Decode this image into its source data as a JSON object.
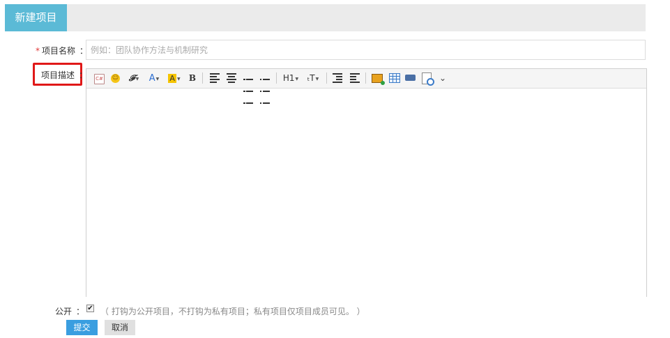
{
  "header": {
    "title": "新建项目"
  },
  "form": {
    "name_required_mark": "*",
    "name_label": "项目名称",
    "colon": "：",
    "name_placeholder": "例如：团队协作方法与机制研究",
    "desc_label": "项目描述",
    "open_label": "公开",
    "open_checked": true,
    "check_glyph": "✔",
    "open_hint": "（ 打钩为公开项目，不打钩为私有项目；私有项目仅项目成员可见。 ）",
    "submit_label": "提交",
    "cancel_label": "取消"
  },
  "toolbar": {
    "html_glyph": "C#",
    "emoticon_glyph": "☺",
    "font_glyph": "𝓕",
    "font_color_glyph": "A",
    "highlight_glyph": "A",
    "bold_glyph": "B",
    "heading_glyph": "H1",
    "font_size_glyph": "ₜT",
    "more_glyph": "⌄"
  },
  "icons": {
    "toolbar": [
      "html-source-icon",
      "emoticon-icon",
      "font-family-icon",
      "font-color-icon",
      "highlight-icon",
      "bold-icon",
      "align-left-icon",
      "align-center-icon",
      "ordered-list-icon",
      "unordered-list-icon",
      "heading-icon",
      "font-size-icon",
      "indent-icon",
      "outdent-icon",
      "insert-image-icon",
      "insert-table-icon",
      "insert-video-icon",
      "preview-icon",
      "more-icon"
    ]
  },
  "colors": {
    "header_accent": "#5bbad6",
    "highlight_border": "#e01818",
    "submit_button": "#3a9ee0"
  }
}
